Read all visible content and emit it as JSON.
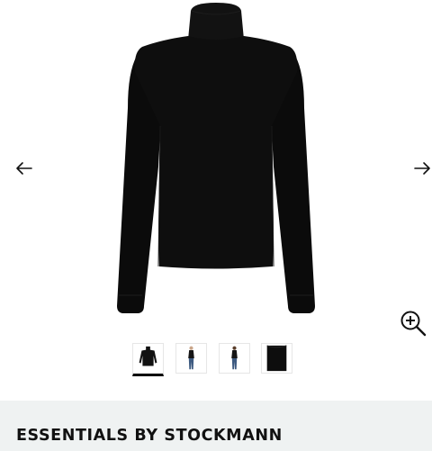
{
  "product": {
    "brand": "ESSENTIALS BY STOCKMANN"
  },
  "gallery": {
    "main_image": "black-turtleneck-sweater",
    "previous_icon": "arrow-left-icon",
    "next_icon": "arrow-right-icon",
    "zoom_icon": "zoom-in-icon",
    "selected_thumbnail": 1,
    "thumbnails": [
      {
        "image": "sweater-front"
      },
      {
        "image": "model-full-front"
      },
      {
        "image": "model-full-back"
      },
      {
        "image": "sweater-fabric-closeup"
      }
    ]
  },
  "colors": {
    "brand_bar": "#eff2f2",
    "garment": "#0b0b0b"
  }
}
